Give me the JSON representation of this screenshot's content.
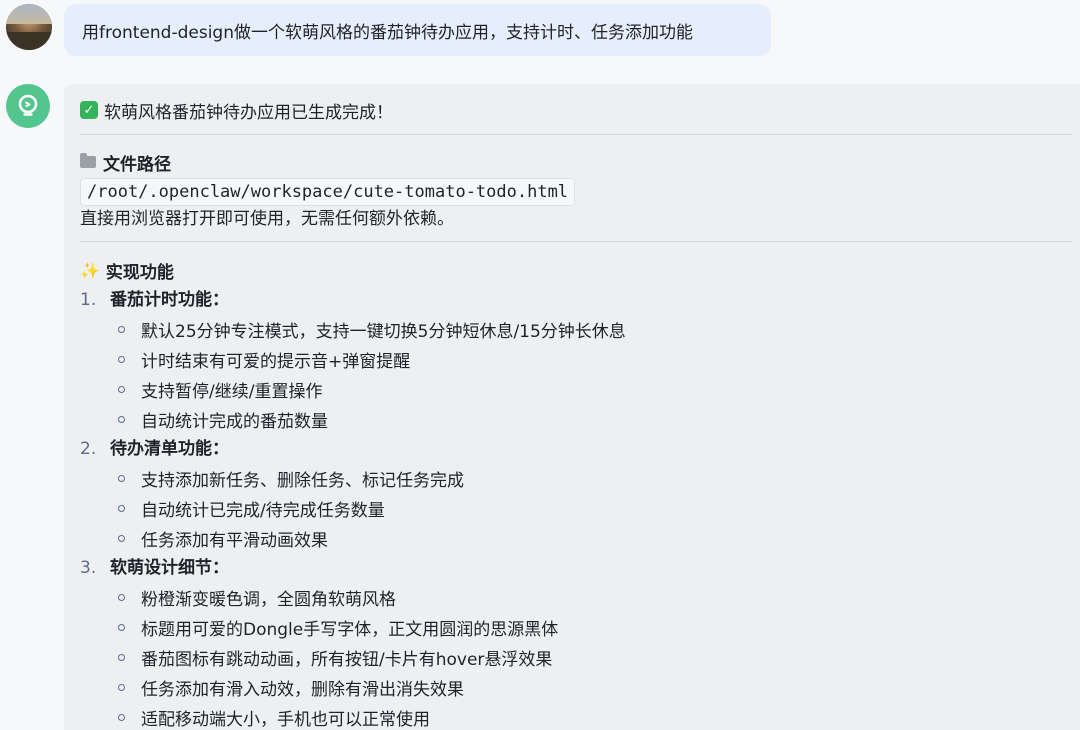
{
  "user": {
    "message": "用frontend-design做一个软萌风格的番茄钟待办应用，支持计时、任务添加功能"
  },
  "bot": {
    "status": "软萌风格番茄钟待办应用已生成完成！",
    "file_section": {
      "title": "文件路径",
      "path": "/root/.openclaw/workspace/cute-tomato-todo.html",
      "note": "直接用浏览器打开即可使用，无需任何额外依赖。"
    },
    "features": {
      "title": "实现功能",
      "items": [
        {
          "number": "1.",
          "title": "番茄计时功能：",
          "bullets": [
            "默认25分钟专注模式，支持一键切换5分钟短休息/15分钟长休息",
            "计时结束有可爱的提示音+弹窗提醒",
            "支持暂停/继续/重置操作",
            "自动统计完成的番茄数量"
          ]
        },
        {
          "number": "2.",
          "title": "待办清单功能：",
          "bullets": [
            "支持添加新任务、删除任务、标记任务完成",
            "自动统计已完成/待完成任务数量",
            "任务添加有平滑动画效果"
          ]
        },
        {
          "number": "3.",
          "title": "软萌设计细节：",
          "bullets": [
            "粉橙渐变暖色调，全圆角软萌风格",
            "标题用可爱的Dongle手写字体，正文用圆润的思源黑体",
            "番茄图标有跳动动画，所有按钮/卡片有hover悬浮效果",
            "任务添加有滑入动效，删除有滑出消失效果",
            "适配移动端大小，手机也可以正常使用"
          ]
        }
      ]
    }
  },
  "icons": {
    "user_avatar": "user-avatar-photo",
    "bot_avatar": "lightbulb-icon",
    "status": "check-mark-icon",
    "file_section": "folder-icon",
    "features": "sparkle-icon"
  },
  "colors": {
    "user_bubble": "#e6eefb",
    "bot_avatar": "#53c68f",
    "bot_bubble": "#eeeff1",
    "check": "#34b35a",
    "list_marker": "#5b6b8c"
  }
}
